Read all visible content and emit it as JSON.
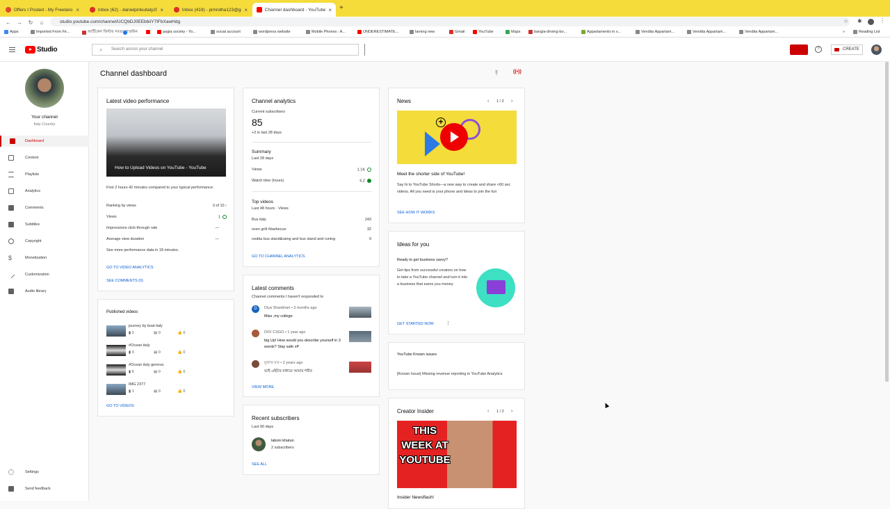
{
  "browser": {
    "tabs": [
      {
        "title": "Offers I Posted - My Freelance",
        "color": "#e04a2b"
      },
      {
        "title": "Inbox (62) - danielpinkuitaly20",
        "color": "#d93025"
      },
      {
        "title": "Inbox (419) - pimridha123@gm",
        "color": "#d93025"
      },
      {
        "title": "Channel dashboard - YouTube",
        "color": "#ff0000"
      }
    ],
    "url": "studio.youtube.com/channel/UCQbDJ0EEbbiiY7IFbXawHdg",
    "bookmarks": [
      "Apps",
      "Imported From Fir...",
      "আর্টিকেল ফিল্টার সবগুলো",
      "জমিন",
      "",
      "pagla society - Yo...",
      "social account",
      "wordpress website",
      "Mobile Phones : A...",
      "UNDERESTIMATE...",
      "larning new",
      "Gmail",
      "YouTube",
      "Maps",
      "bangla-driving-bo...",
      "Appartamento in v...",
      "Vendita Appartam...",
      "Vendita Appartam...",
      "Vendita Appartam..."
    ],
    "reading_list": "Reading List"
  },
  "header": {
    "logo_text": "Studio",
    "search_placeholder": "Search across your channel",
    "create_label": "CREATE"
  },
  "sidebar": {
    "channel_name": "Your channel",
    "channel_sub": "Italy Country",
    "items": [
      {
        "label": "Dashboard",
        "icon": "dashboard-icon"
      },
      {
        "label": "Content",
        "icon": "content-icon"
      },
      {
        "label": "Playlists",
        "icon": "playlists-icon"
      },
      {
        "label": "Analytics",
        "icon": "analytics-icon"
      },
      {
        "label": "Comments",
        "icon": "comments-icon"
      },
      {
        "label": "Subtitles",
        "icon": "subtitles-icon"
      },
      {
        "label": "Copyright",
        "icon": "copyright-icon"
      },
      {
        "label": "Monetization",
        "icon": "monetization-icon"
      },
      {
        "label": "Customization",
        "icon": "customization-icon"
      },
      {
        "label": "Audio library",
        "icon": "audio-library-icon"
      }
    ],
    "settings": "Settings",
    "feedback": "Send feedback"
  },
  "page": {
    "title": "Channel dashboard"
  },
  "latest_video": {
    "title": "Latest video performance",
    "video_title": "How to Upload Videos on YouTube - YouTube",
    "compare": "First 2 hours 42 minutes compared to your typical performance:",
    "rows": [
      {
        "label": "Ranking by views",
        "value": "3 of 10"
      },
      {
        "label": "Views",
        "value": "1"
      },
      {
        "label": "Impressions click-through rate",
        "value": "—"
      },
      {
        "label": "Average view duration",
        "value": "—"
      }
    ],
    "more": "See more performance data in 18 minutes.",
    "link1": "GO TO VIDEO ANALYTICS",
    "link2": "SEE COMMENTS (0)"
  },
  "published": {
    "title": "Published videos",
    "videos": [
      {
        "title": "journey by boat italy",
        "views": "2",
        "comments": "0",
        "likes": "0"
      },
      {
        "title": "#Ocean italy",
        "views": "3",
        "comments": "0",
        "likes": "0"
      },
      {
        "title": "#Ocean italy genova",
        "views": "6",
        "comments": "0",
        "likes": "0"
      },
      {
        "title": "IMG 2377",
        "views": "1",
        "comments": "0",
        "likes": "0"
      }
    ],
    "link": "GO TO VIDEOS"
  },
  "analytics": {
    "title": "Channel analytics",
    "subs_label": "Current subscribers",
    "subs_value": "85",
    "subs_delta": "+2 in last 28 days",
    "summary_title": "Summary",
    "summary_sub": "Last 28 days",
    "summary_rows": [
      {
        "label": "Views",
        "value": "1.1K"
      },
      {
        "label": "Watch time (hours)",
        "value": "6.2"
      }
    ],
    "top_title": "Top videos",
    "top_sub": "Last 48 hours · Views",
    "top_rows": [
      {
        "label": "Bus italy",
        "value": "243"
      },
      {
        "label": "oven grill #barbecue",
        "value": "32"
      },
      {
        "label": "nodda bus stand&raing and bus stand and runing",
        "value": "9"
      }
    ],
    "link": "GO TO CHANNEL ANALYTICS"
  },
  "comments": {
    "title": "Latest comments",
    "sub": "Channel comments I haven't responded to",
    "items": [
      {
        "meta": "Diya Shankhari • 3 months ago",
        "text": "Miss ,my college",
        "avatar": "D"
      },
      {
        "meta": "DIIX CSGO • 1 year ago",
        "text": "big Up! How would you describe yourself in 3 words? Stay safe xP",
        "avatar": ""
      },
      {
        "meta": "মুক্তার মত • 2 years ago",
        "text": "ভাই এইটার মাধ্যমে আমার শরীর",
        "avatar": ""
      }
    ],
    "link": "VIEW MORE"
  },
  "subscribers": {
    "title": "Recent subscribers",
    "sub": "Last 90 days",
    "name": "laboni khatun",
    "count": "2 subscribers",
    "link": "SEE ALL"
  },
  "news": {
    "title": "News",
    "pager": "1 / 2",
    "headline": "Meet the shorter side of YouTube!",
    "body": "Say hi to YouTube Shorts—a new way to create and share <60 sec videos. All you need is your phone and ideas to join the fun",
    "link": "SEE HOW IT WORKS"
  },
  "ideas": {
    "title": "Ideas for you",
    "headline": "Ready to get business savvy?",
    "body": "Get tips from successful creators on how to take a YouTube channel and turn it into a business that earns you money",
    "link": "GET STARTED NOW"
  },
  "known": {
    "title": "YouTube Known issues",
    "body": "[Known Issue] Missing revenue reporting in YouTube Analytics"
  },
  "creator": {
    "title": "Creator Insider",
    "pager": "1 / 2",
    "image_text": "THIS WEEK AT YOUTUBE",
    "headline": "Insider Newsflash!"
  }
}
